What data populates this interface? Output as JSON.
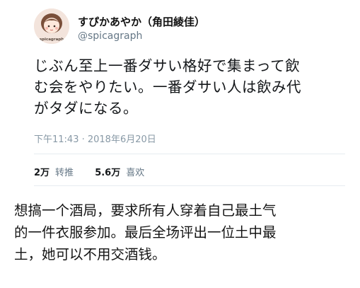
{
  "tweet": {
    "display_name": "すぴかあやか（角田綾佳）",
    "handle": "@spicagraph",
    "avatar_text": "spicagraph",
    "text": "じぶん至上一番ダサい格好で集まって飲\nむ会をやりたい。一番ダサい人は飲み代\nがタダになる。",
    "timestamp": "下午11:43 · 2018年6月20日",
    "retweets": {
      "count": "2万",
      "label": "转推"
    },
    "likes": {
      "count": "5.6万",
      "label": "喜欢"
    }
  },
  "caption": "想搞一个酒局，要求所有人穿着自己最土气\n的一件衣服参加。最后全场评出一位土中最\n土，她可以不用交酒钱。",
  "colors": {
    "secondary_text": "#657786",
    "timestamp": "#8899a6",
    "divider": "#e6ecf0",
    "avatar_bg": "#f6e9e3"
  }
}
